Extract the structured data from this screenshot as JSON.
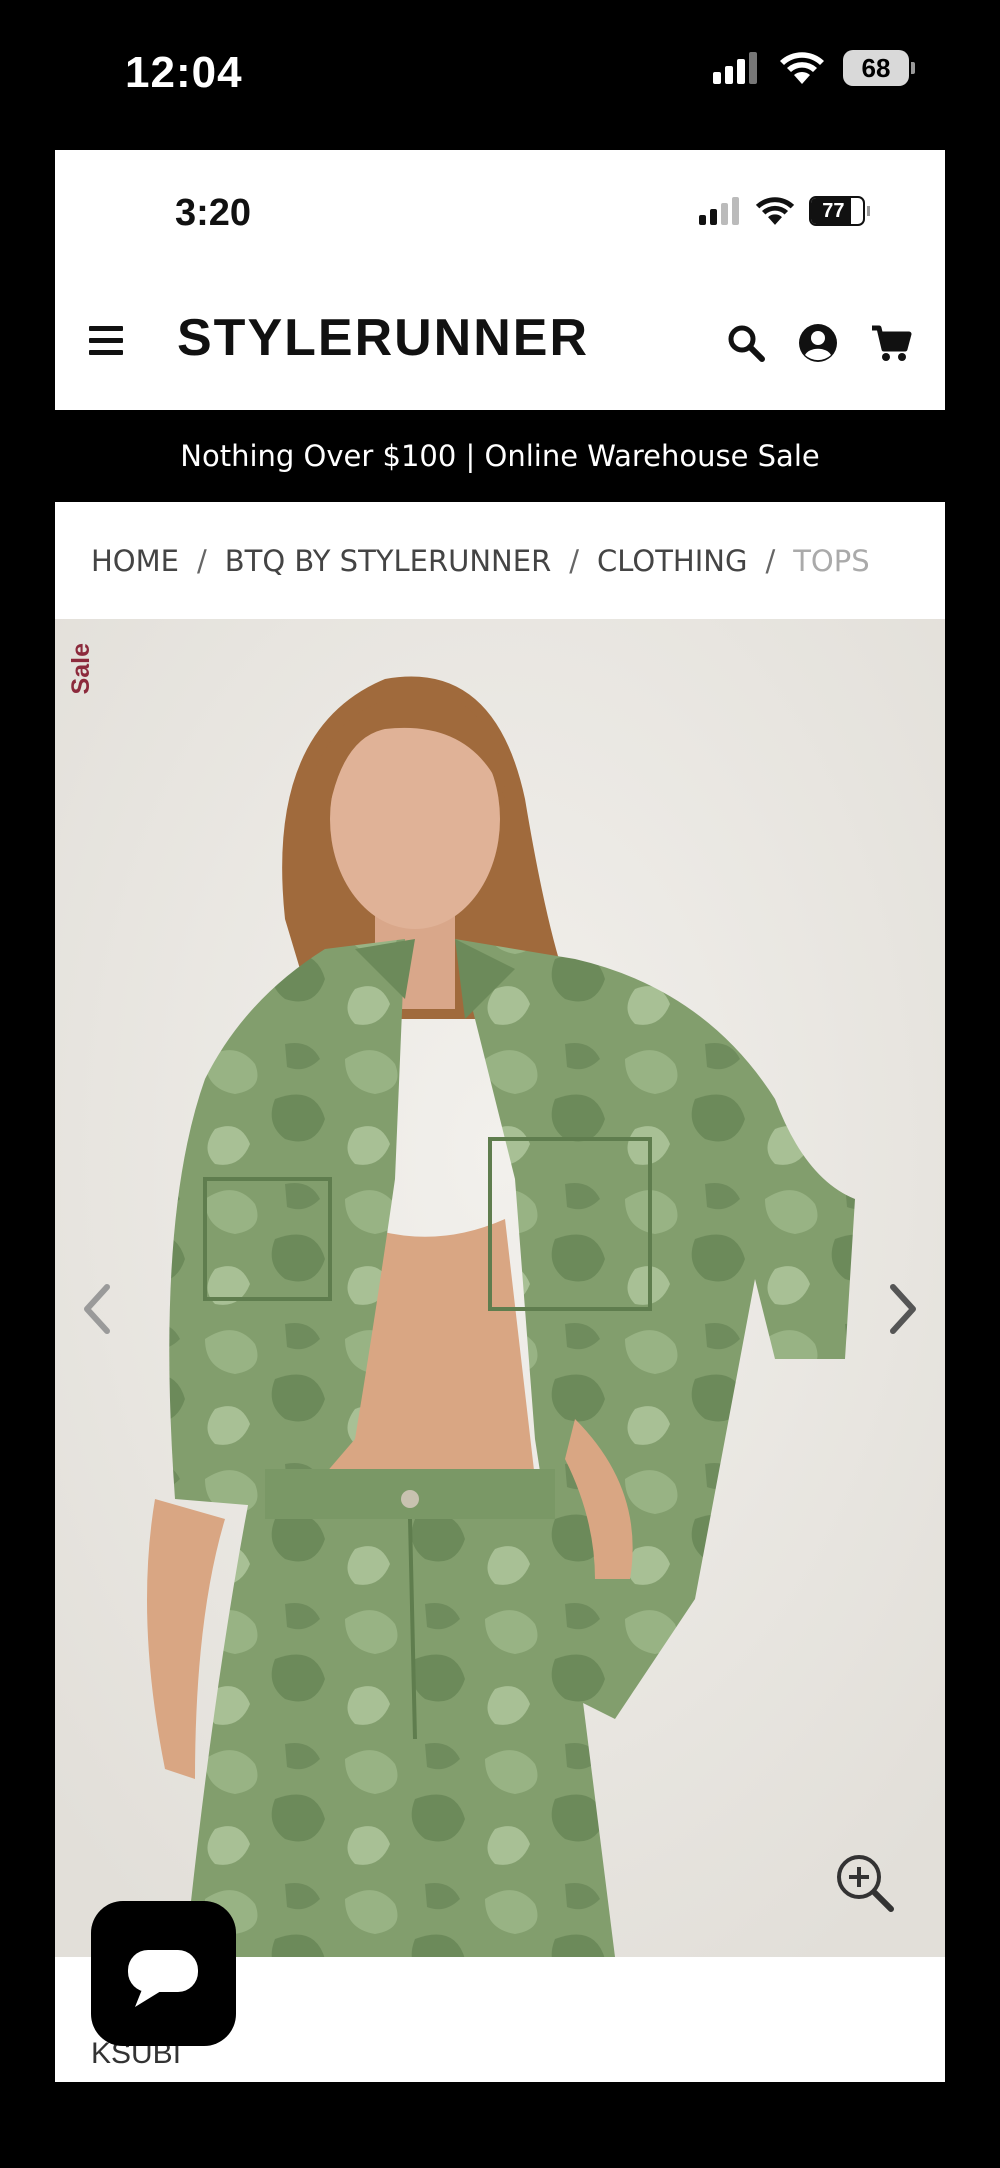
{
  "outer_status": {
    "time": "12:04",
    "battery": "68"
  },
  "inner_status": {
    "time": "3:20",
    "battery": "77"
  },
  "header": {
    "brand": "STYLERUNNER"
  },
  "promo": {
    "text": "Nothing Over $100 | Online Warehouse Sale"
  },
  "breadcrumb": {
    "items": [
      "HOME",
      "BTQ BY STYLERUNNER",
      "CLOTHING",
      "TOPS"
    ],
    "separator": "/"
  },
  "product": {
    "badge": "Sale",
    "brand": "KSUBI"
  },
  "colors": {
    "sale": "#8c2a3c",
    "camo_base": "#7e9a6a",
    "background": "#ece9e4"
  },
  "icons": [
    "menu-icon",
    "search-icon",
    "account-icon",
    "cart-icon",
    "chevron-left-icon",
    "chevron-right-icon",
    "zoom-in-icon",
    "chat-icon",
    "signal-icon",
    "wifi-icon",
    "battery-icon"
  ]
}
